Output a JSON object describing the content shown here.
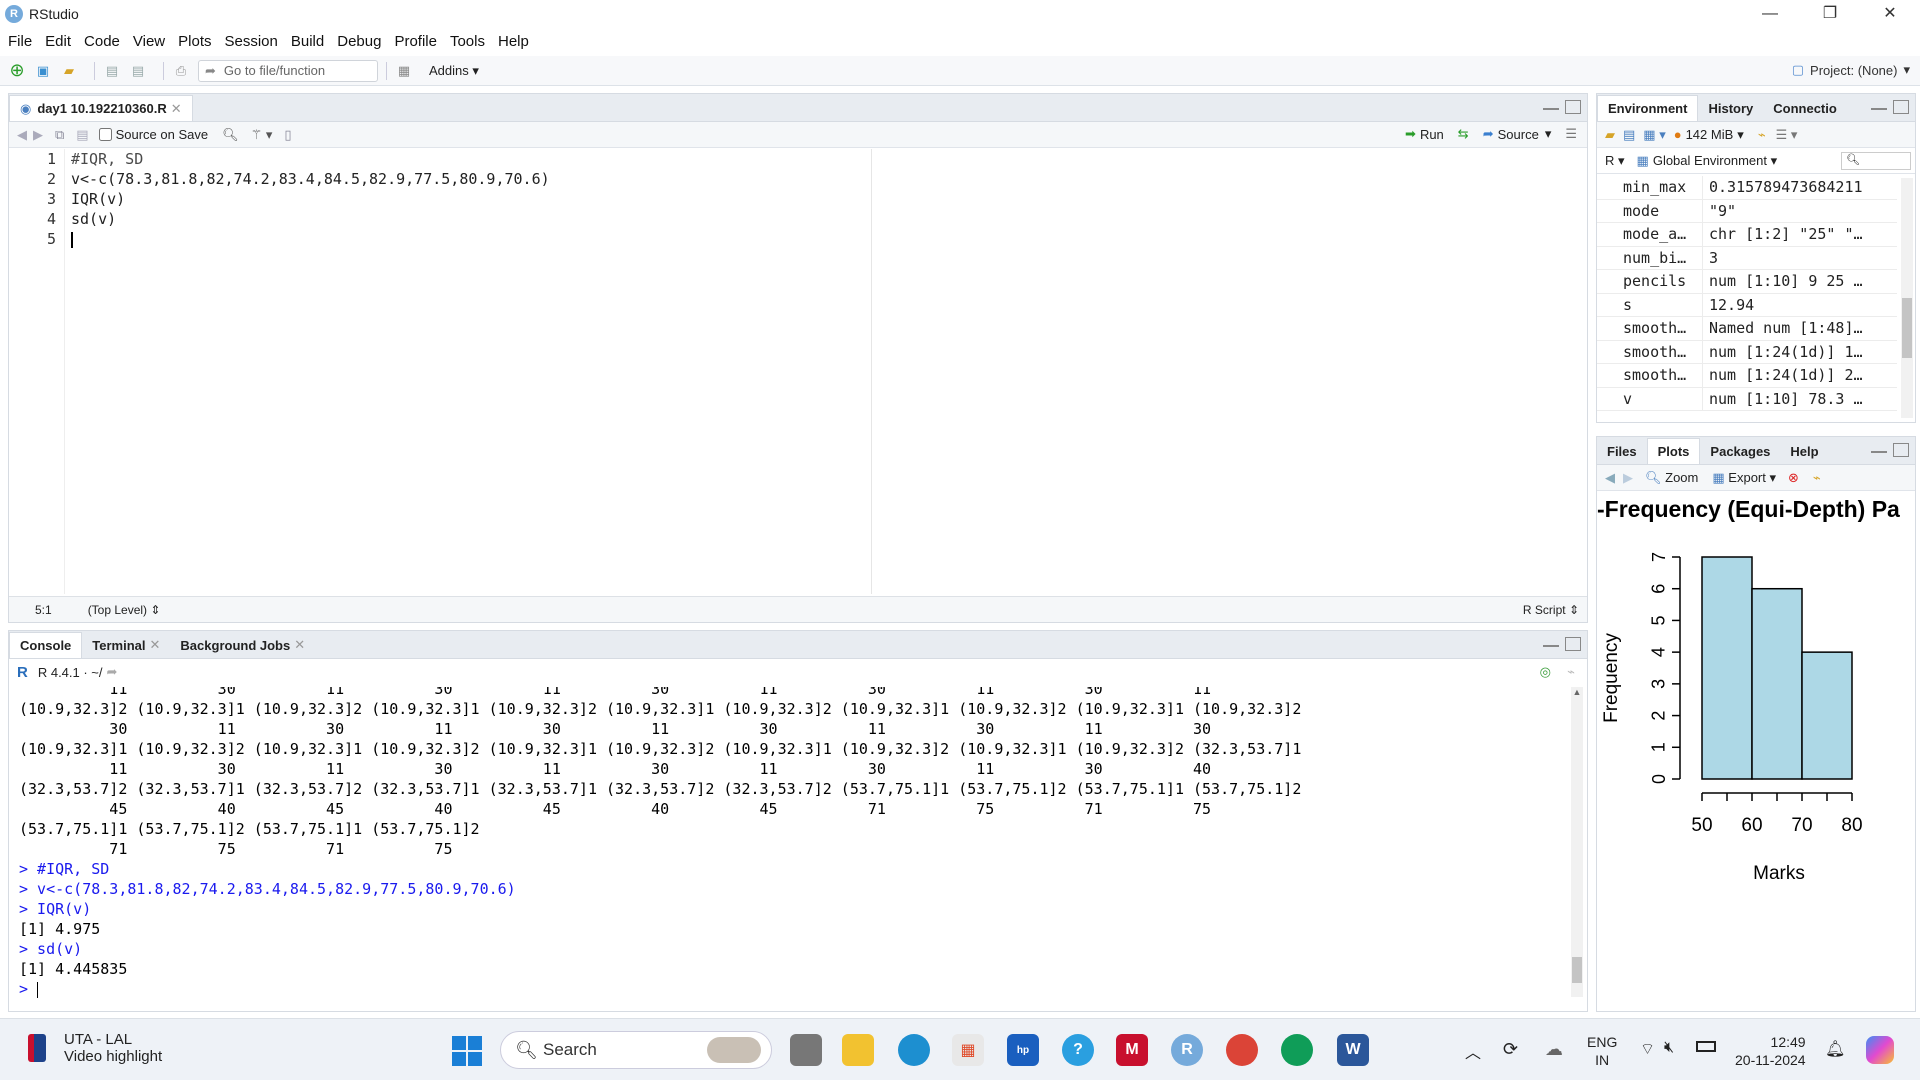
{
  "window": {
    "title": "RStudio",
    "controls": [
      "—",
      "❐",
      "✕"
    ]
  },
  "menu": [
    "File",
    "Edit",
    "Code",
    "View",
    "Plots",
    "Session",
    "Build",
    "Debug",
    "Profile",
    "Tools",
    "Help"
  ],
  "toolbar": {
    "goto_placeholder": "Go to file/function",
    "addins_label": "Addins",
    "project_label": "Project: (None)"
  },
  "editor": {
    "tab_label": "day1 10.192210360.R",
    "source_on_save": "Source on Save",
    "run_label": "Run",
    "source_label": "Source",
    "line_numbers": [
      "1",
      "2",
      "3",
      "4",
      "5"
    ],
    "lines": [
      "#IQR, SD",
      "v<-c(78.3,81.8,82,74.2,83.4,84.5,82.9,77.5,80.9,70.6)",
      "IQR(v)",
      "sd(v)",
      ""
    ],
    "cursor_pos": "5:1",
    "scope": "(Top Level)",
    "file_type": "R Script"
  },
  "console": {
    "tabs": [
      "Console",
      "Terminal",
      "Background Jobs"
    ],
    "r_version": "R 4.4.1 · ~/",
    "output": [
      "          11          30          11          30          11          30          11          30          11          30          11",
      "(10.9,32.3]2 (10.9,32.3]1 (10.9,32.3]2 (10.9,32.3]1 (10.9,32.3]2 (10.9,32.3]1 (10.9,32.3]2 (10.9,32.3]1 (10.9,32.3]2 (10.9,32.3]1 (10.9,32.3]2",
      "          30          11          30          11          30          11          30          11          30          11          30",
      "(10.9,32.3]1 (10.9,32.3]2 (10.9,32.3]1 (10.9,32.3]2 (10.9,32.3]1 (10.9,32.3]2 (10.9,32.3]1 (10.9,32.3]2 (10.9,32.3]1 (10.9,32.3]2 (32.3,53.7]1",
      "          11          30          11          30          11          30          11          30          11          30          40",
      "(32.3,53.7]2 (32.3,53.7]1 (32.3,53.7]2 (32.3,53.7]1 (32.3,53.7]1 (32.3,53.7]2 (32.3,53.7]2 (53.7,75.1]1 (53.7,75.1]2 (53.7,75.1]1 (53.7,75.1]2",
      "          45          40          45          40          45          40          45          71          75          71          75",
      "(53.7,75.1]1 (53.7,75.1]2 (53.7,75.1]1 (53.7,75.1]2",
      "          71          75          71          75"
    ],
    "commands": [
      {
        "text": "> #IQR, SD",
        "type": "cmd"
      },
      {
        "text": "> v<-c(78.3,81.8,82,74.2,83.4,84.5,82.9,77.5,80.9,70.6)",
        "type": "cmd"
      },
      {
        "text": "> IQR(v)",
        "type": "cmd"
      },
      {
        "text": "[1] 4.975",
        "type": "out"
      },
      {
        "text": "> sd(v)",
        "type": "cmd"
      },
      {
        "text": "[1] 4.445835",
        "type": "out"
      },
      {
        "text": "> ",
        "type": "cmd"
      }
    ]
  },
  "environment": {
    "tabs": [
      "Environment",
      "History",
      "Connectio"
    ],
    "memory": "142 MiB",
    "scope": "Global Environment",
    "language": "R",
    "rows": [
      {
        "name": "min_max",
        "value": "0.315789473684211"
      },
      {
        "name": "mode",
        "value": "\"9\""
      },
      {
        "name": "mode_a…",
        "value": "chr [1:2] \"25\" \"…"
      },
      {
        "name": "num_bi…",
        "value": "3"
      },
      {
        "name": "pencils",
        "value": "num [1:10] 9 25 …"
      },
      {
        "name": "s",
        "value": "12.94"
      },
      {
        "name": "smooth…",
        "value": "Named num [1:48]…"
      },
      {
        "name": "smooth…",
        "value": "num [1:24(1d)] 1…"
      },
      {
        "name": "smooth…",
        "value": "num [1:24(1d)] 2…"
      },
      {
        "name": "v",
        "value": "num [1:10] 78.3 …"
      }
    ]
  },
  "plots": {
    "tabs": [
      "Files",
      "Plots",
      "Packages",
      "Help"
    ],
    "zoom_label": "Zoom",
    "export_label": "Export"
  },
  "chart_data": {
    "type": "bar",
    "title": "-Frequency (Equi-Depth) Pa",
    "xlabel": "Marks",
    "ylabel": "Frequency",
    "bins": [
      [
        50,
        60
      ],
      [
        60,
        70
      ],
      [
        70,
        80
      ]
    ],
    "values": [
      7,
      6,
      4
    ],
    "x_ticks": [
      "50",
      "60",
      "70",
      "80"
    ],
    "y_ticks": [
      "0",
      "1",
      "2",
      "3",
      "4",
      "5",
      "6",
      "7"
    ],
    "xlim": [
      50,
      80
    ],
    "ylim": [
      0,
      7
    ],
    "bar_color": "#add8e6"
  },
  "taskbar": {
    "news_title": "UTA - LAL",
    "news_sub": "Video highlight",
    "search_label": "Search",
    "lang": "ENG",
    "region": "IN",
    "time": "12:49",
    "date": "20-11-2024"
  }
}
